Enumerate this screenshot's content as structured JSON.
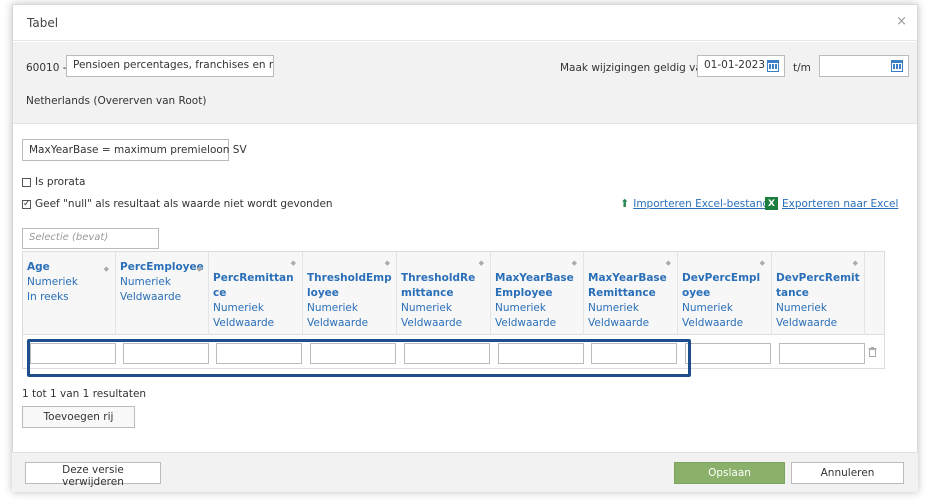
{
  "dialog": {
    "title": "Tabel",
    "close_glyph": "×"
  },
  "header": {
    "code": "60010 -",
    "table_name": "Pensioen percentages, franchises en max",
    "valid_from_label": "Maak wijzigingen geldig van",
    "valid_from_value": "01-01-2023",
    "to_label": "t/m",
    "valid_to_value": "",
    "country": "Netherlands (Overerven van Root)"
  },
  "description": "MaxYearBase = maximum premieloon SV",
  "options": {
    "prorata_label": "Is prorata",
    "prorata_checked": false,
    "null_label": "Geef \"null\" als resultaat als waarde niet wordt gevonden",
    "null_checked": true
  },
  "links": {
    "import": "Importeren Excel-bestand",
    "export": "Exporteren naar Excel"
  },
  "filter": {
    "placeholder": "Selectie (bevat)"
  },
  "columns": [
    {
      "name": "Age",
      "type": "Numeriek",
      "mode": "In reeks"
    },
    {
      "name": "PercEmployee",
      "type": "Numeriek",
      "mode": "Veldwaarde"
    },
    {
      "name": "PercRemittance",
      "type": "Numeriek",
      "mode": "Veldwaarde"
    },
    {
      "name": "ThresholdEmployee",
      "type": "Numeriek",
      "mode": "Veldwaarde"
    },
    {
      "name": "ThresholdRemittance",
      "type": "Numeriek",
      "mode": "Veldwaarde"
    },
    {
      "name": "MaxYearBaseEmployee",
      "type": "Numeriek",
      "mode": "Veldwaarde"
    },
    {
      "name": "MaxYearBaseRemittance",
      "type": "Numeriek",
      "mode": "Veldwaarde"
    },
    {
      "name": "DevPercEmployee",
      "type": "Numeriek",
      "mode": "Veldwaarde"
    },
    {
      "name": "DevPercRemittance",
      "type": "Numeriek",
      "mode": "Veldwaarde"
    }
  ],
  "results_text": "1 tot 1 van 1 resultaten",
  "buttons": {
    "add_row": "Toevoegen rij",
    "delete_version": "Deze versie verwijderen",
    "save": "Opslaan",
    "cancel": "Annuleren"
  },
  "colors": {
    "link": "#2a6fb8",
    "save": "#8ab06a",
    "highlight": "#1f4e8c"
  },
  "icons": [
    "close-icon",
    "calendar-icon",
    "upload-icon",
    "excel-icon",
    "sort-icon",
    "trash-icon"
  ]
}
